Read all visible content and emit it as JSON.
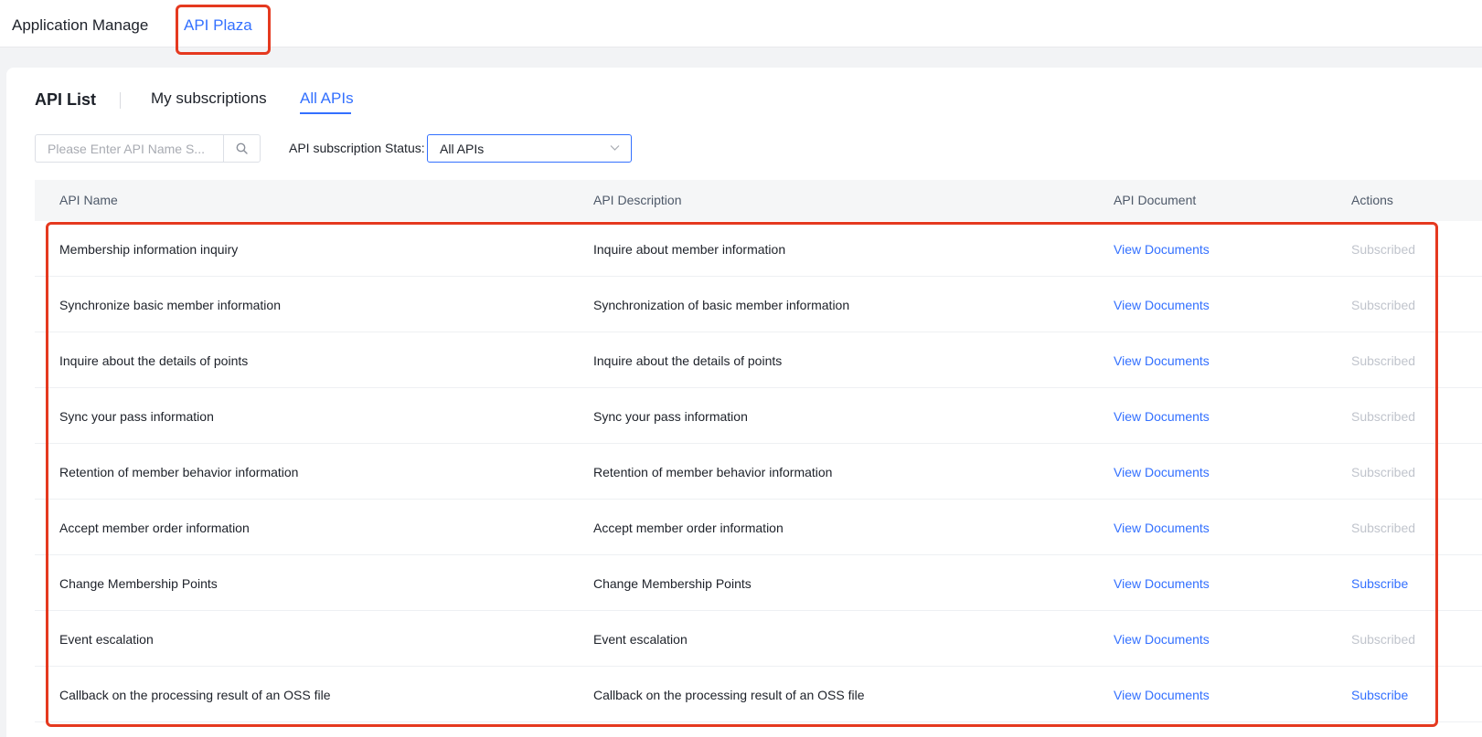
{
  "top_nav": {
    "tabs": [
      {
        "label": "Application Manage"
      },
      {
        "label": "API Plaza"
      }
    ]
  },
  "page": {
    "title": "API List",
    "tabs": [
      {
        "label": "My subscriptions"
      },
      {
        "label": "All APIs"
      }
    ]
  },
  "filters": {
    "search_placeholder": "Please Enter API Name S...",
    "search_value": "",
    "status_label": "API subscription Status:",
    "status_value": "All APIs"
  },
  "table": {
    "headers": {
      "name": "API Name",
      "description": "API Description",
      "document": "API Document",
      "actions": "Actions"
    },
    "rows": [
      {
        "name": "Membership information inquiry",
        "description": "Inquire about member information",
        "document": "View Documents",
        "action": "Subscribed"
      },
      {
        "name": "Synchronize basic member information",
        "description": "Synchronization of basic member information",
        "document": "View Documents",
        "action": "Subscribed"
      },
      {
        "name": "Inquire about the details of points",
        "description": "Inquire about the details of points",
        "document": "View Documents",
        "action": "Subscribed"
      },
      {
        "name": "Sync your pass information",
        "description": "Sync your pass information",
        "document": "View Documents",
        "action": "Subscribed"
      },
      {
        "name": "Retention of member behavior information",
        "description": "Retention of member behavior information",
        "document": "View Documents",
        "action": "Subscribed"
      },
      {
        "name": "Accept member order information",
        "description": "Accept member order information",
        "document": "View Documents",
        "action": "Subscribed"
      },
      {
        "name": "Change Membership Points",
        "description": "Change Membership Points",
        "document": "View Documents",
        "action": "Subscribe"
      },
      {
        "name": "Event escalation",
        "description": "Event escalation",
        "document": "View Documents",
        "action": "Subscribed"
      },
      {
        "name": "Callback on the processing result of an OSS file",
        "description": "Callback on the processing result of an OSS file",
        "document": "View Documents",
        "action": "Subscribe"
      }
    ]
  },
  "colors": {
    "accent": "#3370ff",
    "highlight": "#e5391f",
    "disabled_text": "#c0c4cc"
  },
  "icons": {
    "search": "search-icon",
    "dropdown": "chevron-down-icon"
  }
}
